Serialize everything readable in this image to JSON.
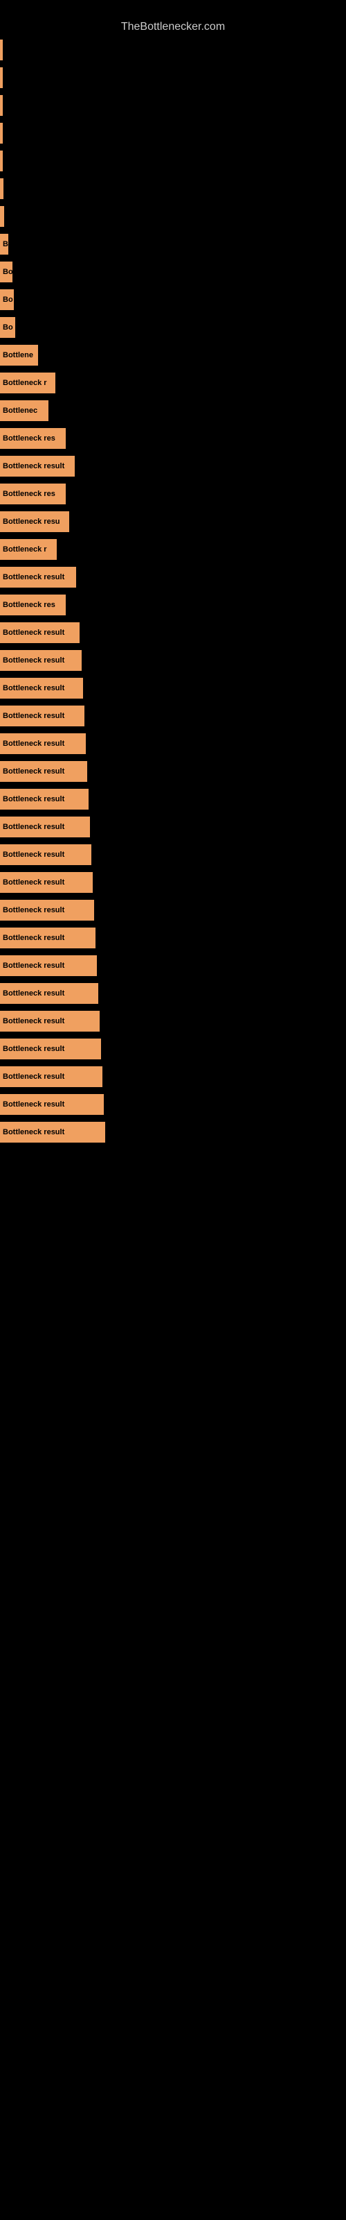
{
  "site": {
    "title": "TheBottlenecker.com"
  },
  "bars": [
    {
      "label": "",
      "width": 2
    },
    {
      "label": "",
      "width": 3
    },
    {
      "label": "",
      "width": 3
    },
    {
      "label": "",
      "width": 4
    },
    {
      "label": "",
      "width": 4
    },
    {
      "label": "",
      "width": 5
    },
    {
      "label": "",
      "width": 6
    },
    {
      "label": "B",
      "width": 12
    },
    {
      "label": "Bo",
      "width": 18
    },
    {
      "label": "Bo",
      "width": 20
    },
    {
      "label": "Bo",
      "width": 22
    },
    {
      "label": "Bottlene",
      "width": 55
    },
    {
      "label": "Bottleneck r",
      "width": 80
    },
    {
      "label": "Bottlenec",
      "width": 70
    },
    {
      "label": "Bottleneck res",
      "width": 95
    },
    {
      "label": "Bottleneck result",
      "width": 108
    },
    {
      "label": "Bottleneck res",
      "width": 95
    },
    {
      "label": "Bottleneck resu",
      "width": 100
    },
    {
      "label": "Bottleneck r",
      "width": 82
    },
    {
      "label": "Bottleneck result",
      "width": 110
    },
    {
      "label": "Bottleneck res",
      "width": 95
    },
    {
      "label": "Bottleneck result",
      "width": 115
    },
    {
      "label": "Bottleneck result",
      "width": 118
    },
    {
      "label": "Bottleneck result",
      "width": 120
    },
    {
      "label": "Bottleneck result",
      "width": 122
    },
    {
      "label": "Bottleneck result",
      "width": 124
    },
    {
      "label": "Bottleneck result",
      "width": 126
    },
    {
      "label": "Bottleneck result",
      "width": 128
    },
    {
      "label": "Bottleneck result",
      "width": 130
    },
    {
      "label": "Bottleneck result",
      "width": 132
    },
    {
      "label": "Bottleneck result",
      "width": 134
    },
    {
      "label": "Bottleneck result",
      "width": 136
    },
    {
      "label": "Bottleneck result",
      "width": 138
    },
    {
      "label": "Bottleneck result",
      "width": 140
    },
    {
      "label": "Bottleneck result",
      "width": 142
    },
    {
      "label": "Bottleneck result",
      "width": 144
    },
    {
      "label": "Bottleneck result",
      "width": 146
    },
    {
      "label": "Bottleneck result",
      "width": 148
    },
    {
      "label": "Bottleneck result",
      "width": 150
    },
    {
      "label": "Bottleneck result",
      "width": 152
    }
  ]
}
